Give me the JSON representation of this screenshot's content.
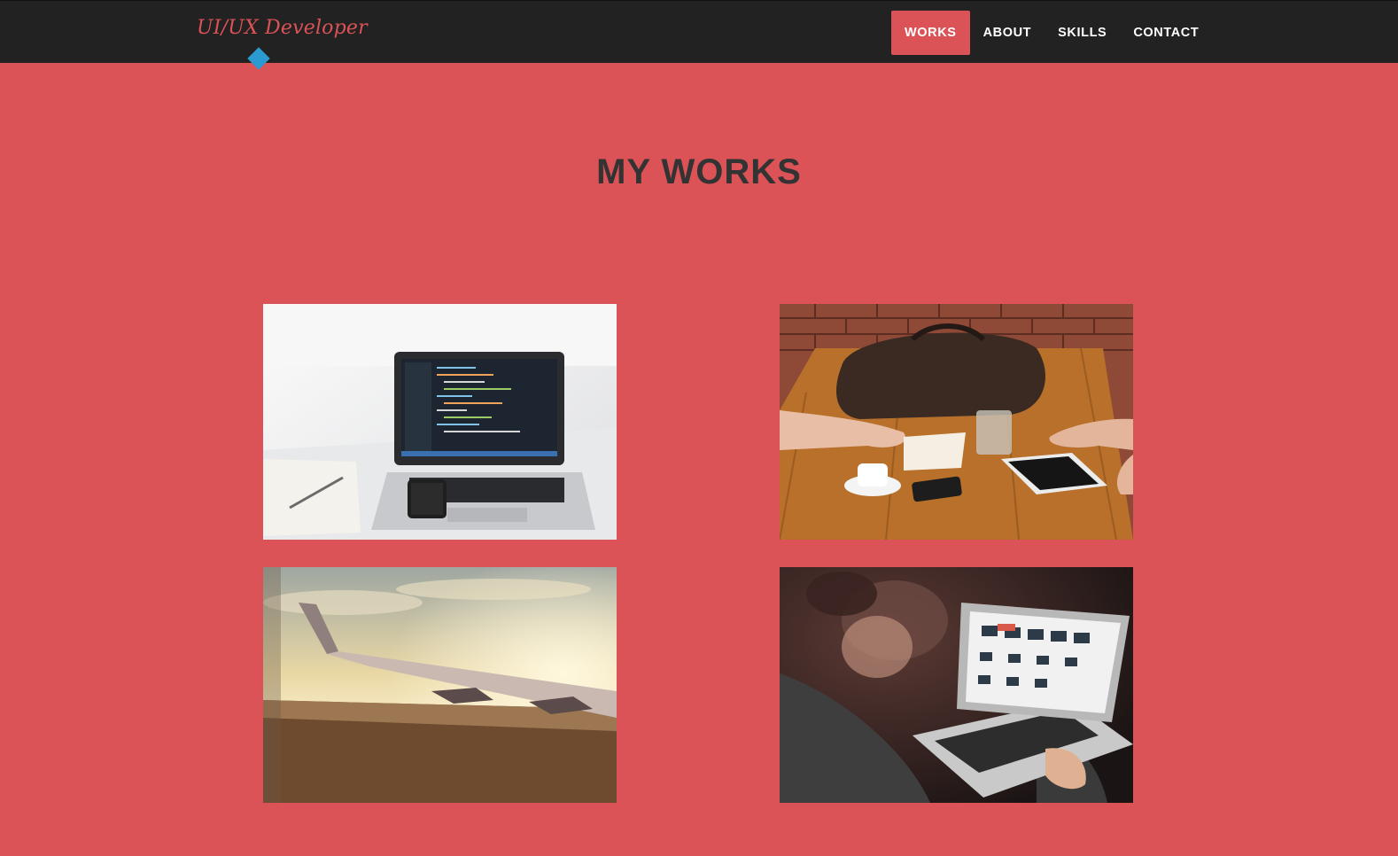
{
  "brand": {
    "name": "UI/UX Developer"
  },
  "nav": {
    "items": [
      {
        "label": "WORKS",
        "active": true
      },
      {
        "label": "ABOUT",
        "active": false
      },
      {
        "label": "SKILLS",
        "active": false
      },
      {
        "label": "CONTACT",
        "active": false
      }
    ]
  },
  "works": {
    "title": "MY WORKS",
    "items": [
      {
        "image": "laptop-with-code-on-desk"
      },
      {
        "image": "meeting-table-with-tablet-and-coffee"
      },
      {
        "image": "airplane-wing-at-sunset"
      },
      {
        "image": "person-using-laptop"
      }
    ]
  },
  "colors": {
    "background": "#db5356",
    "navbar": "#222222",
    "brand_text": "#db5356",
    "active_tab": "#db5356",
    "accent_diamond": "#2b9ad1",
    "title_text": "#333333",
    "nav_text": "#ffffff"
  }
}
